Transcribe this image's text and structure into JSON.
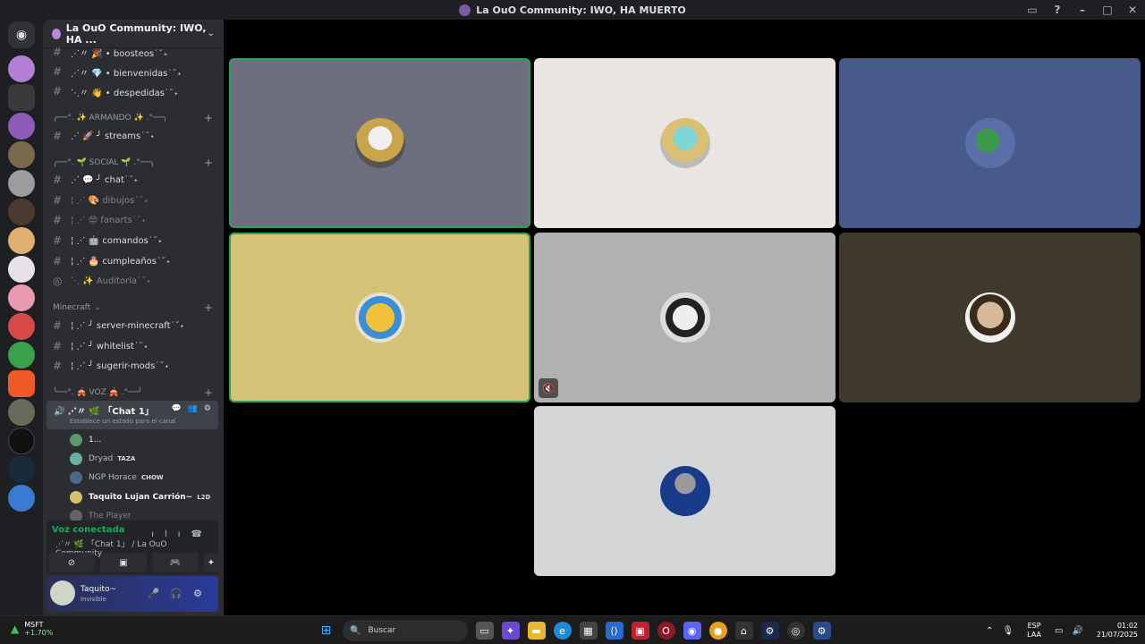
{
  "window": {
    "title": "La OuO Community: IWO, HA MUERTO"
  },
  "sidebar": {
    "server_name": "La OuO Community: IWO, HA ...",
    "channels_top": [
      {
        "label": "⋰〃 🎉 • boosteos˙ ᷃ ˖"
      },
      {
        "label": "⋰〃 💎 • bienvenidas˙ ᷃ ˖"
      },
      {
        "label": "⋱〃 👋 • despedidas˙ ᷃ ˖"
      }
    ],
    "cat_armando": "╭──°. ✨ ARMANDO ✨ .°──╮",
    "channel_streams": "⋰ 🚀 ╯ streams˙ ᷃ ˖",
    "cat_social": "╭──°. 🌱 SOCIAL 🌱 .°──╮",
    "channels_social": [
      {
        "label": "⋰ 💬 ╯ chat˙ ᷃ ˖"
      },
      {
        "label": "¦ ⋰ 🎨 dibujos˙ ᷃ ˖"
      },
      {
        "label": "¦ ⋰ 😍 fanarts˙ ᷃ ˖"
      },
      {
        "label": "¦ ⋰ 🤖 comandos˙ ᷃ ˖"
      },
      {
        "label": "¦ ⋰ 🎂 cumpleaños˙ ᷃ ˖"
      },
      {
        "label": "⋱ ✨ Auditoria˙ ᷃ ˖"
      }
    ],
    "cat_minecraft": "Minecraft",
    "channels_mc": [
      {
        "label": "¦ ⋰ ╯ server-minecraft˙ ᷃ ˖"
      },
      {
        "label": "¦ ⋰ ╯ whitelist˙ ᷃ ˖"
      },
      {
        "label": "¦ ⋰ ╯ sugerir-mods˙ ᷃ ˖"
      }
    ],
    "cat_voz": "╰──°. 🎪 VOZ 🎪 .°──╯",
    "voice_channel": {
      "name": "⋰〃 🌿 「Chat 1」",
      "status": "Establece un estado para el canal"
    },
    "voice_users": [
      {
        "name": "1...",
        "tag": ""
      },
      {
        "name": "Dryad",
        "tag": "TAZA"
      },
      {
        "name": "NGP Horace",
        "tag": "CHOW"
      },
      {
        "name": "Taquito Lujan Carrión~",
        "tag": "L2D"
      },
      {
        "name": "The Player",
        "tag": ""
      }
    ]
  },
  "voice_panel": {
    "connected_label": "Voz conectada",
    "location": "⋰〃 🌿 「Chat 1」 / La OuO Community..."
  },
  "user_panel": {
    "name": "Taquito~",
    "status": "Invisible"
  },
  "stage": {
    "tiles": [
      {
        "bg": "#6e6f7e",
        "speaking": true,
        "muted": false
      },
      {
        "bg": "#e9e6e1",
        "speaking": false,
        "muted": false
      },
      {
        "bg": "#475a8a",
        "speaking": false,
        "muted": false
      },
      {
        "bg": "#d4c276",
        "speaking": true,
        "muted": false
      },
      {
        "bg": "#b1b1b1",
        "speaking": false,
        "muted": true
      },
      {
        "bg": "#3f3a2c",
        "speaking": false,
        "muted": false
      },
      {
        "bg": "#d5d6d8",
        "speaking": false,
        "muted": false
      }
    ]
  },
  "taskbar": {
    "stock_name": "MSFT",
    "stock_change": "+1.70%",
    "search_placeholder": "Buscar",
    "lang_top": "ESP",
    "lang_bottom": "LAA",
    "time": "01:02",
    "date": "21/07/2025"
  }
}
